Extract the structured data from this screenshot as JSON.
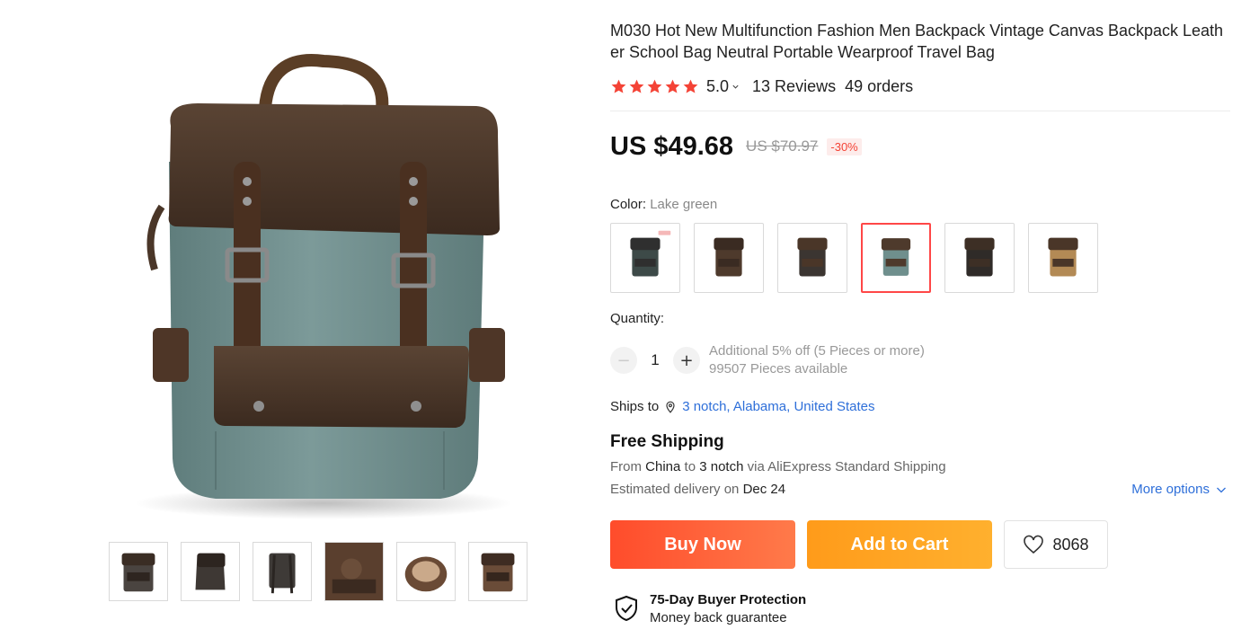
{
  "product": {
    "title": "M030 Hot New Multifunction Fashion Men Backpack Vintage Canvas Backpack Leather School Bag Neutral Portable Wearproof Travel Bag",
    "rating_value": "5.0",
    "stars": 5,
    "reviews": "13 Reviews",
    "orders": "49 orders"
  },
  "price": {
    "current": "US $49.68",
    "original": "US $70.97",
    "discount": "-30%"
  },
  "color": {
    "label": "Color:",
    "selected": "Lake green",
    "swatch_colors": [
      {
        "body": "#3d4a48",
        "flap": "#2f2f2f",
        "badge": true
      },
      {
        "body": "#4e3a2c",
        "flap": "#3a2b22",
        "badge": false
      },
      {
        "body": "#3b3531",
        "flap": "#4a3628",
        "badge": false
      },
      {
        "body": "#6f8f8d",
        "flap": "#4e3a2c",
        "badge": false
      },
      {
        "body": "#2f2b28",
        "flap": "#3d2f25",
        "badge": false
      },
      {
        "body": "#b38a55",
        "flap": "#4a3628",
        "badge": false
      }
    ],
    "selected_index": 3
  },
  "quantity": {
    "label": "Quantity:",
    "value": "1",
    "minus_symbol": "−",
    "plus_symbol": "+",
    "discount_note": "Additional 5% off (5 Pieces or more)",
    "available": "99507 Pieces available"
  },
  "shipping": {
    "ships_to_label": "Ships to",
    "destination": "3 notch, Alabama, United States",
    "free_label": "Free Shipping",
    "from_word": "From",
    "origin": "China",
    "to_word": "to",
    "to_city": "3 notch",
    "via_text": "via AliExpress Standard Shipping",
    "est_text": "Estimated delivery on",
    "est_date": "Dec 24",
    "more_options": "More options"
  },
  "actions": {
    "buy_now": "Buy Now",
    "add_to_cart": "Add to Cart",
    "wishlist_count": "8068"
  },
  "protection": {
    "title": "75-Day Buyer Protection",
    "subtitle": "Money back guarantee"
  },
  "gallery": {
    "thumb_count": 6
  },
  "colors": {
    "accent_red": "#ff4747",
    "star": "#f44336",
    "link_blue": "#2e6fd9",
    "buy_now": "#ff4c2b",
    "add_to_cart": "#ff9b1a"
  },
  "icons": [
    "star-icon",
    "chevron-down-icon",
    "location-pin-icon",
    "heart-icon",
    "shield-check-icon",
    "minus-icon",
    "plus-icon"
  ]
}
